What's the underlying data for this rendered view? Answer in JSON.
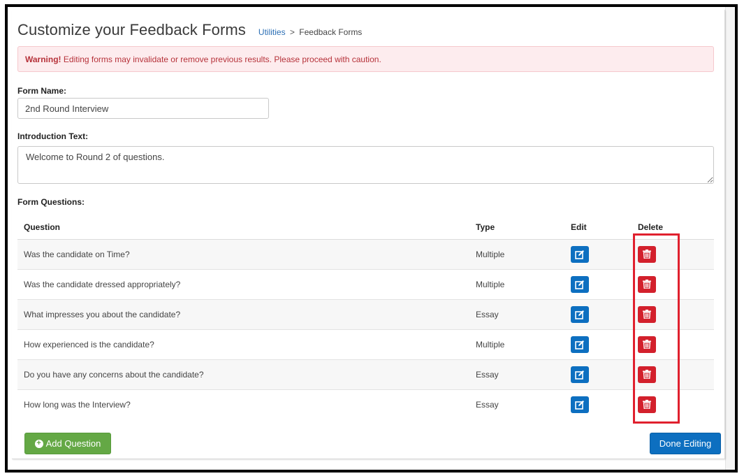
{
  "header": {
    "title": "Customize your Feedback Forms",
    "breadcrumb": {
      "link": "Utilities",
      "separator": ">",
      "current": "Feedback Forms"
    }
  },
  "warning": {
    "strong": "Warning!",
    "message": "Editing forms may invalidate or remove previous results. Please proceed with caution."
  },
  "form": {
    "name_label": "Form Name:",
    "name_value": "2nd Round Interview",
    "intro_label": "Introduction Text:",
    "intro_value": "Welcome to Round 2 of questions.",
    "questions_label": "Form Questions:"
  },
  "table": {
    "headers": {
      "question": "Question",
      "type": "Type",
      "edit": "Edit",
      "delete": "Delete"
    },
    "rows": [
      {
        "question": "Was the candidate on Time?",
        "type": "Multiple"
      },
      {
        "question": "Was the candidate dressed appropriately?",
        "type": "Multiple"
      },
      {
        "question": "What impresses you about the candidate?",
        "type": "Essay"
      },
      {
        "question": "How experienced is the candidate?",
        "type": "Multiple"
      },
      {
        "question": "Do you have any concerns about the candidate?",
        "type": "Essay"
      },
      {
        "question": "How long was the Interview?",
        "type": "Essay"
      }
    ]
  },
  "buttons": {
    "add_question": "Add Question",
    "done_editing": "Done Editing"
  },
  "icons": {
    "edit": "edit-icon",
    "delete": "trash-icon",
    "add": "plus-circle-icon"
  },
  "colors": {
    "primary": "#0d6fc0",
    "danger": "#d3202c",
    "success": "#64a845",
    "warning_bg": "#fdecee",
    "warning_text": "#b6323a",
    "highlight": "#e0202e"
  }
}
